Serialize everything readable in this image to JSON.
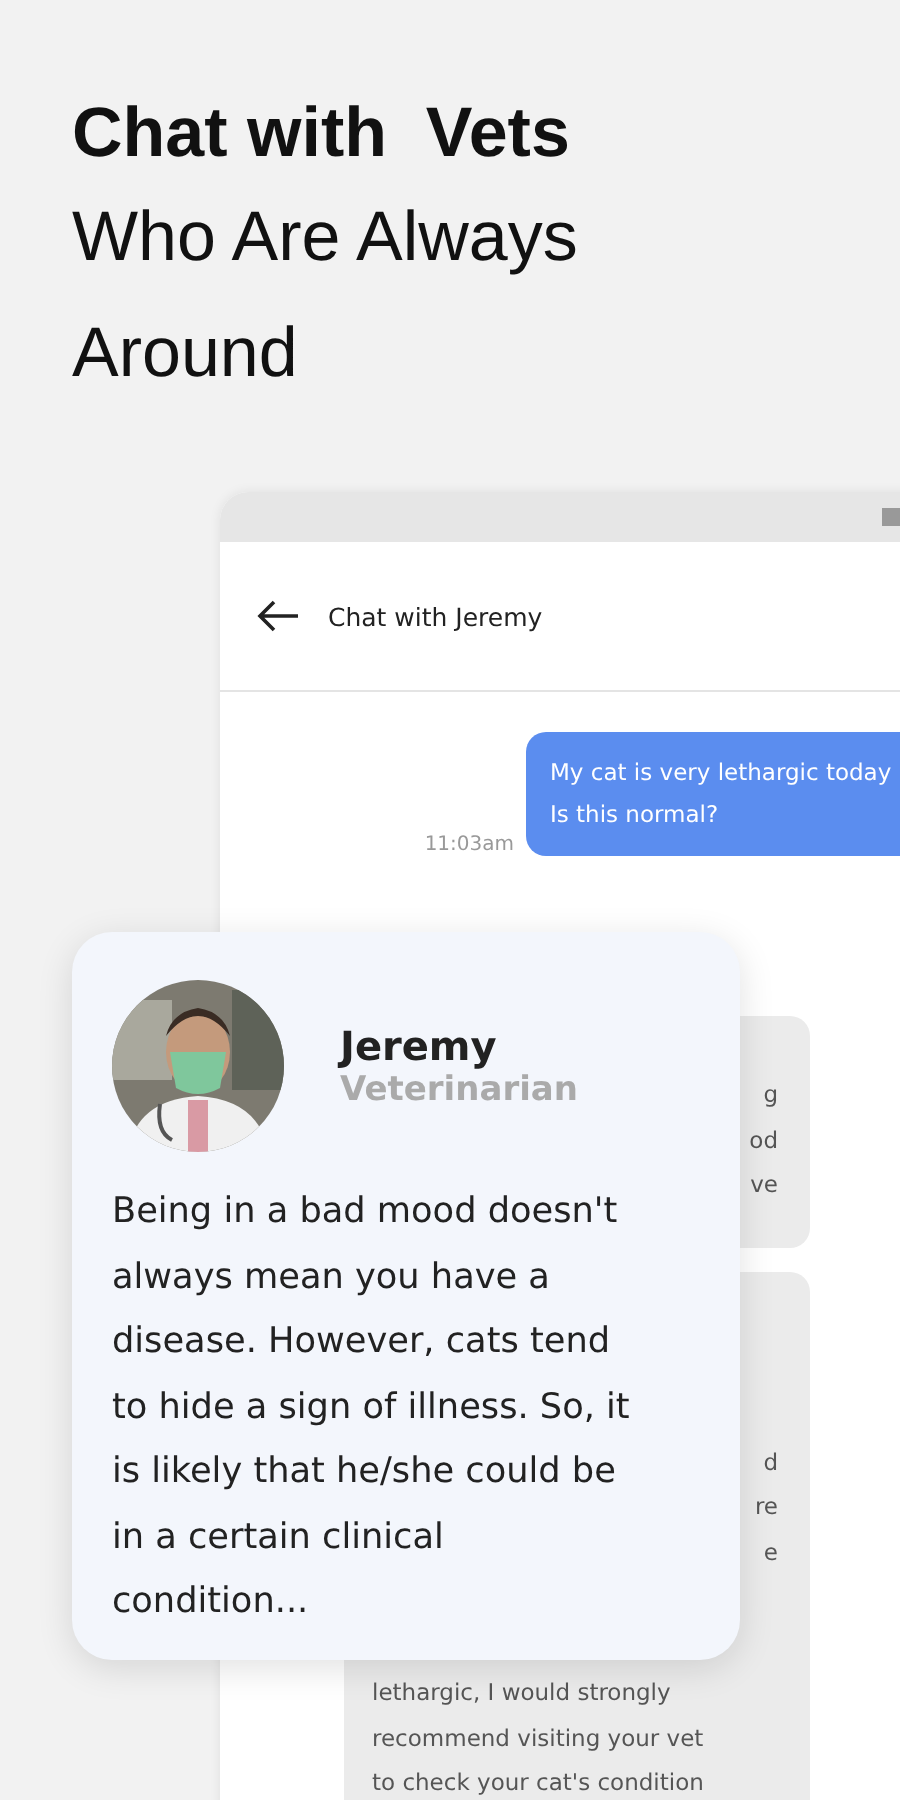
{
  "headline": {
    "bold": "Chat with  Vets",
    "lines": [
      "Who Are Always",
      "Around"
    ]
  },
  "chat": {
    "title": "Chat with Jeremy",
    "messages": [
      {
        "kind": "sent",
        "lines": [
          "My cat is very lethargic today",
          "Is this normal?"
        ],
        "time": "11:03am"
      },
      {
        "kind": "received",
        "lines": [
          "g",
          "od",
          "ve"
        ]
      },
      {
        "kind": "received",
        "lines": [
          "d",
          "re",
          "e",
          "lethargic, I would strongly",
          "recommend visiting your vet",
          "to check your cat's condition"
        ]
      }
    ]
  },
  "card": {
    "name": "Jeremy",
    "role": "Veterinarian",
    "text": "Being in a bad mood doesn't always mean you have a disease. However, cats tend to hide a sign of illness. So, it is likely that he/she could be in a certain clinical condition..."
  }
}
